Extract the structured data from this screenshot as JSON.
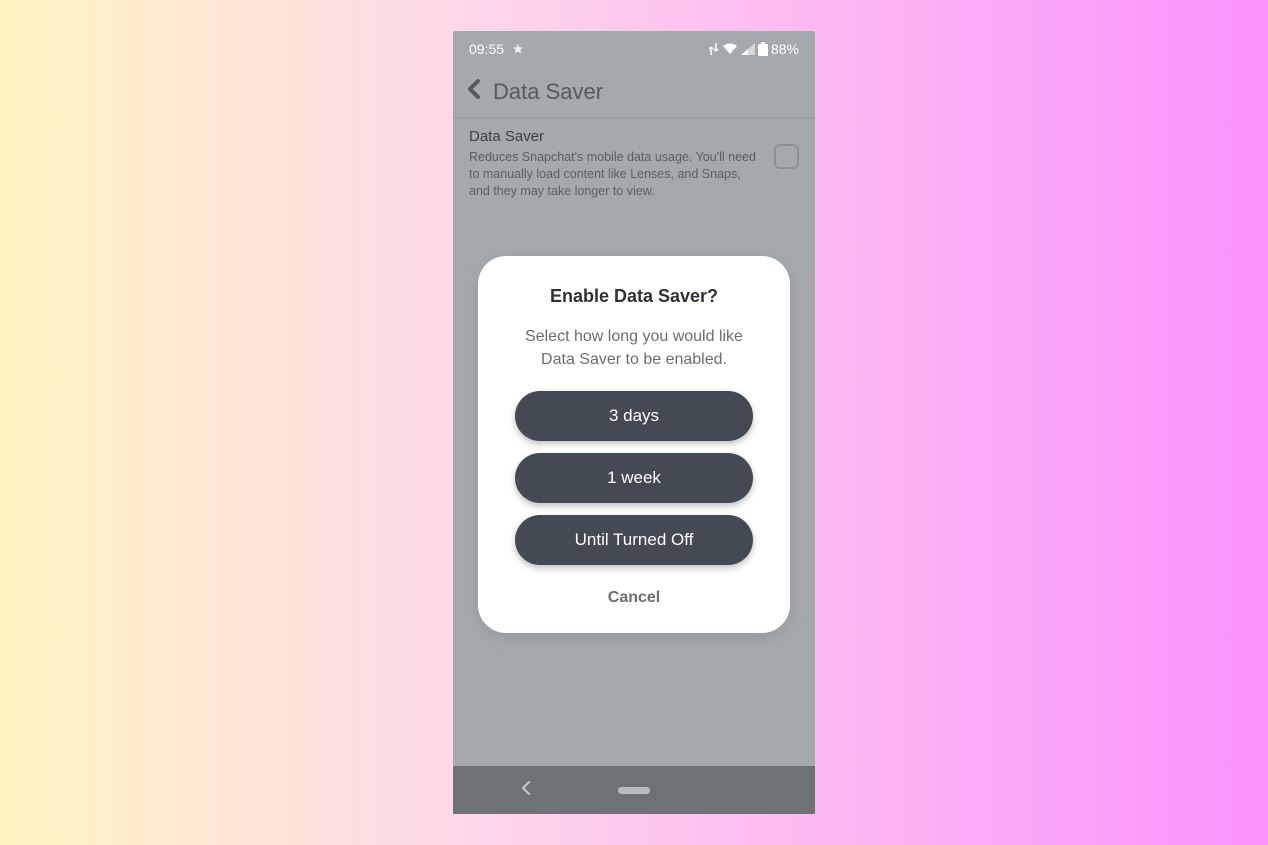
{
  "statusBar": {
    "time": "09:55",
    "batteryText": "88%"
  },
  "header": {
    "title": "Data Saver"
  },
  "setting": {
    "label": "Data Saver",
    "description": "Reduces Snapchat's mobile data usage. You'll need to manually load content like Lenses, and Snaps, and they may take longer to view."
  },
  "modal": {
    "title": "Enable Data Saver?",
    "subtitle": "Select how long you would like Data Saver to be enabled.",
    "options": [
      "3 days",
      "1 week",
      "Until Turned Off"
    ],
    "cancel": "Cancel"
  }
}
